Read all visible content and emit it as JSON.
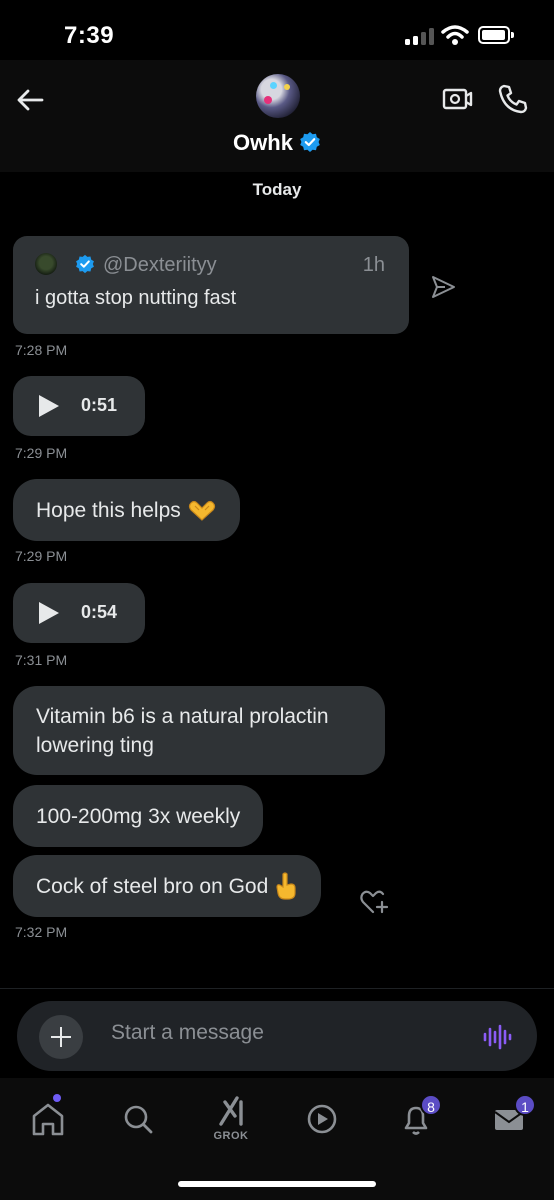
{
  "status": {
    "time": "7:39"
  },
  "header": {
    "contact_name": "Owhk",
    "verified": true
  },
  "date_separator": "Today",
  "messages": [
    {
      "type": "quote",
      "quote_handle": "@Dexteriityy",
      "quote_time": "1h",
      "text": "i gotta stop nutting fast",
      "timestamp": "7:28 PM"
    },
    {
      "type": "voice",
      "duration": "0:51",
      "timestamp": "7:29 PM"
    },
    {
      "type": "text",
      "text": "Hope this helps",
      "emoji": "heart-hands-emoji",
      "timestamp": "7:29 PM"
    },
    {
      "type": "voice",
      "duration": "0:54",
      "timestamp": "7:31 PM"
    },
    {
      "type": "text",
      "text": "Vitamin b6 is a natural prolactin lowering ting"
    },
    {
      "type": "text",
      "text": "100-200mg 3x weekly"
    },
    {
      "type": "text",
      "text": "Cock of steel bro on God",
      "emoji": "pointing-up-emoji",
      "timestamp": "7:32 PM"
    }
  ],
  "composer": {
    "placeholder": "Start a message"
  },
  "tabbar": {
    "grok_label": "GROK",
    "notifications_count": "8",
    "messages_count": "1"
  },
  "colors": {
    "accent_verified": "#1d9bf0",
    "bubble_bg": "#2f3336",
    "badge_purple": "#5b4cc4",
    "voice_icon": "#8b5cf6"
  }
}
